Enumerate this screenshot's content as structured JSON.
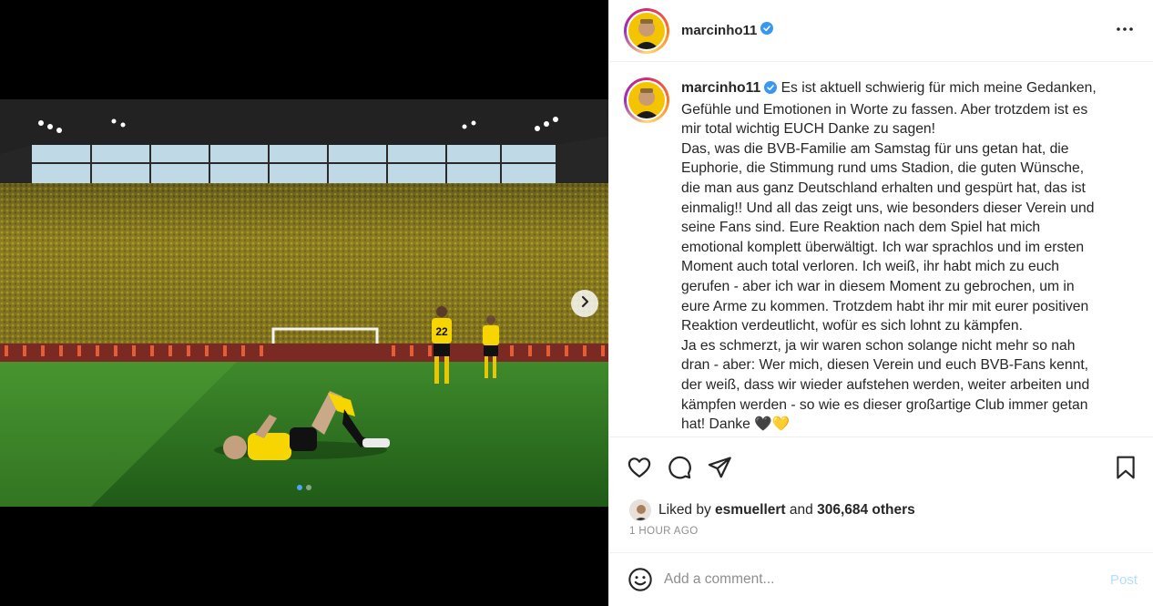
{
  "post": {
    "username": "marcinho11",
    "caption_lines": [
      "Es ist aktuell schwierig für mich meine Gedanken,",
      "Gefühle und Emotionen in Worte zu fassen. Aber trotzdem ist es",
      "mir total wichtig EUCH Danke zu sagen!",
      "Das, was die BVB-Familie am Samstag für uns getan hat, die",
      "Euphorie, die Stimmung rund ums Stadion, die guten Wünsche,",
      "die man aus ganz Deutschland erhalten und gespürt hat, das ist",
      "einmalig!! Und all das zeigt uns, wie besonders dieser Verein und",
      "seine Fans sind. Eure Reaktion nach dem Spiel hat mich",
      "emotional komplett überwältigt. Ich war sprachlos und im ersten",
      "Moment auch total verloren. Ich weiß, ihr habt mich zu euch",
      "gerufen - aber ich war in diesem Moment zu gebrochen, um in",
      "eure Arme zu kommen. Trotzdem habt ihr mir mit eurer positiven",
      "Reaktion verdeutlicht, wofür es sich lohnt zu kämpfen.",
      "Ja es schmerzt, ja wir waren schon solange nicht mehr so nah",
      "dran - aber: Wer mich, diesen Verein und euch BVB-Fans kennt,",
      "der weiß, dass wir wieder aufstehen werden, weiter arbeiten und",
      "kämpfen werden - so wie es dieser großartige Club immer getan",
      "hat! Danke 🖤💛"
    ],
    "likes_prefix": "Liked by",
    "liked_by_user": "esmuellert",
    "likes_and": "and",
    "likes_count": "306,684 others",
    "time_ago": "1 HOUR AGO",
    "player_number": "22"
  },
  "comment_bar": {
    "placeholder": "Add a comment...",
    "post_label": "Post"
  },
  "carousel": {
    "current": 1,
    "total": 2
  },
  "icons": {
    "verified": "verified-badge-icon",
    "more": "more-options-icon",
    "like": "heart-icon",
    "comment": "comment-bubble-icon",
    "share": "paper-plane-icon",
    "save": "bookmark-icon",
    "emoji": "emoji-smiley-icon",
    "next": "chevron-right-icon"
  },
  "colors": {
    "verified_blue": "#3897f0",
    "bvb_yellow": "#fde100",
    "pitch_green": "#2e7d22",
    "post_button_disabled": "#b2dffc"
  }
}
